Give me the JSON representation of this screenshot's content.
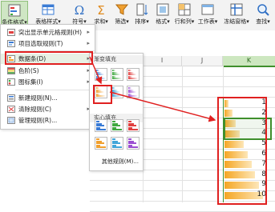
{
  "ribbon": {
    "buttons": [
      {
        "label": "条件格式",
        "suffix": "▾"
      },
      {
        "label": "表格样式",
        "suffix": "▾"
      },
      {
        "label": "符号",
        "suffix": "▾"
      },
      {
        "label": "求和",
        "suffix": "▾"
      },
      {
        "label": "筛选",
        "suffix": "▾"
      },
      {
        "label": "排序",
        "suffix": "▾"
      },
      {
        "label": "格式",
        "suffix": "▾"
      },
      {
        "label": "行和列",
        "suffix": "▾"
      },
      {
        "label": "工作表",
        "suffix": "▾"
      },
      {
        "label": "冻结窗格",
        "suffix": "▾"
      },
      {
        "label": "查找",
        "suffix": "▾"
      }
    ]
  },
  "menu": {
    "items": [
      {
        "label": "突出显示单元格规则(H)",
        "has_sub": true,
        "icon": "highlight-rules-icon"
      },
      {
        "label": "项目选取规则(T)",
        "has_sub": true,
        "icon": "top-bottom-rules-icon"
      },
      {
        "label": "数据条(D)",
        "has_sub": true,
        "icon": "data-bars-icon"
      },
      {
        "label": "色阶(S)",
        "has_sub": true,
        "icon": "color-scales-icon"
      },
      {
        "label": "图标集(I)",
        "has_sub": true,
        "icon": "icon-sets-icon"
      },
      {
        "label": "新建规则(N)...",
        "has_sub": false,
        "icon": "new-rule-icon"
      },
      {
        "label": "清除规则(C)",
        "has_sub": true,
        "icon": "clear-rules-icon"
      },
      {
        "label": "管理规则(R)...",
        "has_sub": false,
        "icon": "manage-rules-icon"
      }
    ],
    "arrow": "▸"
  },
  "submenu": {
    "gradient_title": "渐变填充",
    "solid_title": "实心填充",
    "more_rules": "其他规则(M)..."
  },
  "grid": {
    "columns": [
      "I",
      "J",
      "K"
    ],
    "selected_column": "K",
    "values": [
      "1",
      "2",
      "3",
      "4",
      "5",
      "6",
      "7",
      "8",
      "9",
      "10"
    ],
    "bar_fractions": [
      0.1,
      0.2,
      0.3,
      0.4,
      0.5,
      0.6,
      0.7,
      0.8,
      0.9,
      1.0
    ]
  },
  "colors": {
    "accent": "#3f8f2c",
    "annotation": "#e02020",
    "bar": "#f5a623"
  }
}
